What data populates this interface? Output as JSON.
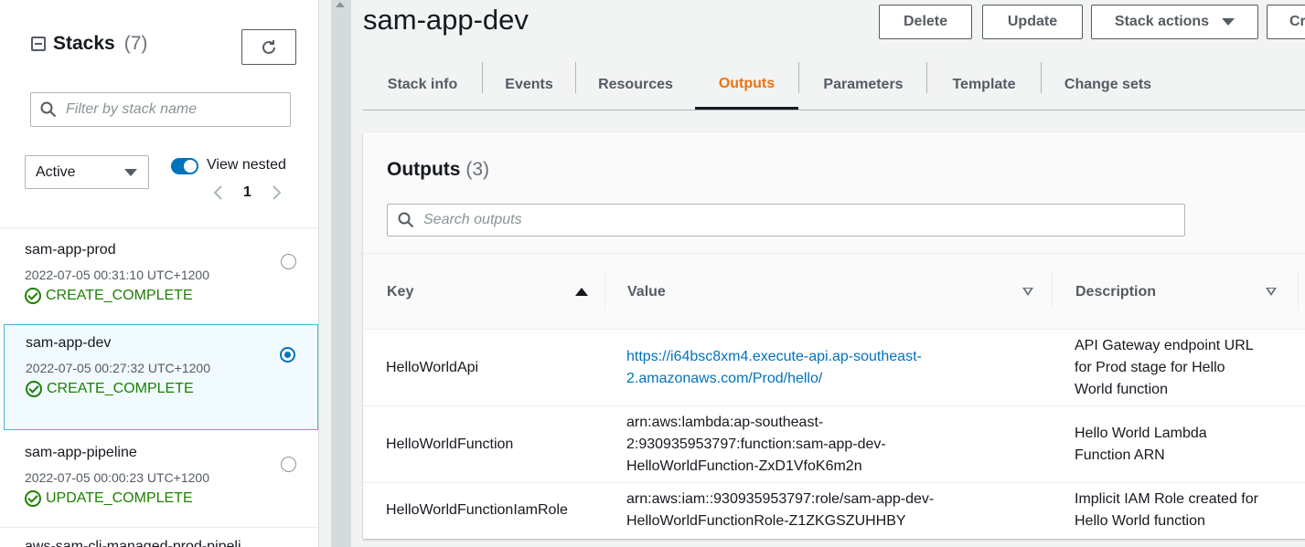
{
  "sidebar": {
    "title": "Stacks",
    "count": "(7)",
    "filter_placeholder": "Filter by stack name",
    "status_filter": "Active",
    "view_nested_label": "View nested",
    "page_number": "1",
    "stacks": [
      {
        "name": "sam-app-prod",
        "time": "2022-07-05 00:31:10 UTC+1200",
        "status": "CREATE_COMPLETE",
        "selected": false
      },
      {
        "name": "sam-app-dev",
        "time": "2022-07-05 00:27:32 UTC+1200",
        "status": "CREATE_COMPLETE",
        "selected": true
      },
      {
        "name": "sam-app-pipeline",
        "time": "2022-07-05 00:00:23 UTC+1200",
        "status": "UPDATE_COMPLETE",
        "selected": false
      },
      {
        "name": "aws-sam-cli-managed-prod-pipeli"
      }
    ]
  },
  "header": {
    "title": "sam-app-dev",
    "buttons": {
      "delete": "Delete",
      "update": "Update",
      "stack_actions": "Stack actions",
      "create": "Cr"
    }
  },
  "tabs": [
    "Stack info",
    "Events",
    "Resources",
    "Outputs",
    "Parameters",
    "Template",
    "Change sets"
  ],
  "active_tab": "Outputs",
  "outputs": {
    "title": "Outputs",
    "count": "(3)",
    "search_placeholder": "Search outputs",
    "columns": [
      "Key",
      "Value",
      "Description"
    ],
    "rows": [
      {
        "key": "HelloWorldApi",
        "value_line1": "https://i64bsc8xm4.execute-api.ap-southeast-",
        "value_line2": "2.amazonaws.com/Prod/hello/",
        "value_line3": "",
        "desc_line1": "API Gateway endpoint URL",
        "desc_line2": "for Prod stage for Hello",
        "desc_line3": "World function"
      },
      {
        "key": "HelloWorldFunction",
        "value_line1": "arn:aws:lambda:ap-southeast-",
        "value_line2": "2:930935953797:function:sam-app-dev-",
        "value_line3": "HelloWorldFunction-ZxD1VfoK6m2n",
        "desc_line1": "Hello World Lambda",
        "desc_line2": "Function ARN",
        "desc_line3": ""
      },
      {
        "key": "HelloWorldFunctionIamRole",
        "value_line1": "arn:aws:iam::930935953797:role/sam-app-dev-",
        "value_line2": "HelloWorldFunctionRole-Z1ZKGSZUHHBY",
        "value_line3": "",
        "desc_line1": "Implicit IAM Role created for",
        "desc_line2": "Hello World function",
        "desc_line3": ""
      }
    ]
  },
  "colors": {
    "accent": "#ec7211",
    "link": "#0073bb",
    "success": "#1d8102"
  }
}
